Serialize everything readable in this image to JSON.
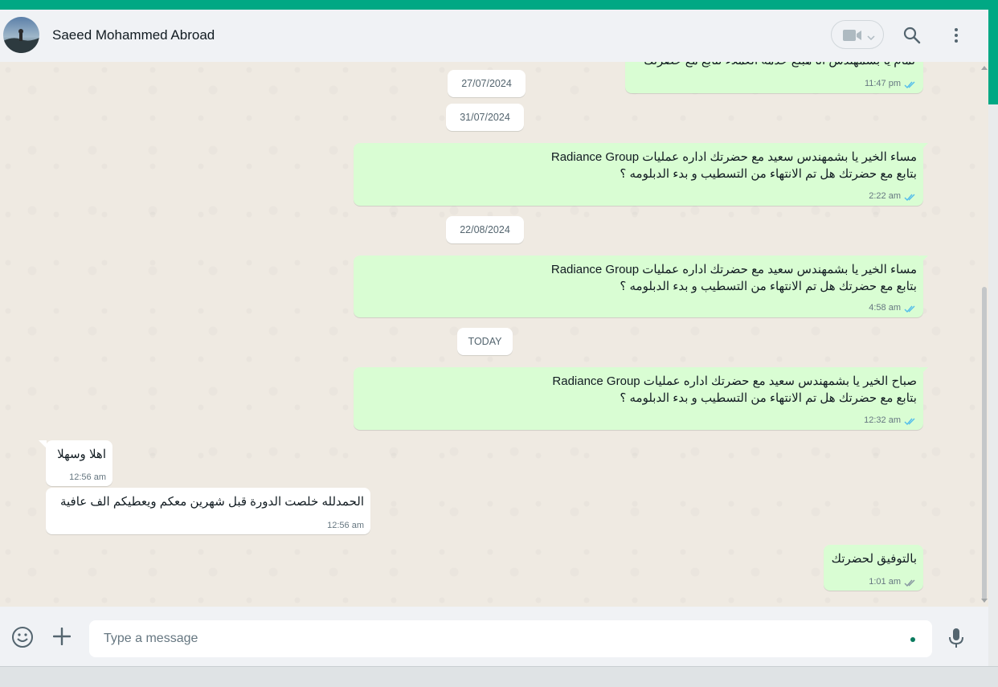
{
  "header": {
    "contact_name": "Saeed Mohammed Abroad"
  },
  "dates": {
    "d1": "27/07/2024",
    "d2": "31/07/2024",
    "d3": "22/08/2024",
    "d4": "TODAY"
  },
  "messages": [
    {
      "direction": "out",
      "text": "تمام يا بشمهندس انا هبلغ خدمه العملاء تتابع مع حضرتك",
      "time": "11:47 pm",
      "status": "read"
    },
    {
      "direction": "out",
      "line1": "مساء الخير يا بشمهندس سعيد مع  حضرتك اداره عمليات Radiance Group",
      "line2": "بتابع مع حضرتك هل تم الانتهاء من التسطيب و بدء الدبلومه ؟",
      "time": "2:22 am",
      "status": "read"
    },
    {
      "direction": "out",
      "line1": "مساء الخير يا بشمهندس سعيد مع  حضرتك اداره عمليات Radiance Group",
      "line2": "بتابع مع حضرتك هل تم الانتهاء من التسطيب و بدء الدبلومه ؟",
      "time": "4:58 am",
      "status": "read"
    },
    {
      "direction": "out",
      "line1": "صباح الخير يا بشمهندس سعيد مع  حضرتك اداره عمليات Radiance Group",
      "line2": "بتابع مع حضرتك هل تم الانتهاء من التسطيب و بدء الدبلومه ؟",
      "time": "12:32 am",
      "status": "read"
    },
    {
      "direction": "in",
      "text": "اهلا وسهلا",
      "time": "12:56 am"
    },
    {
      "direction": "in",
      "text": "الحمدلله خلصت الدورة قبل شهرين معكم ويعطيكم الف عافية",
      "time": "12:56 am"
    },
    {
      "direction": "out",
      "text": "بالتوفيق لحضرتك",
      "time": "1:01 am",
      "status": "delivered"
    }
  ],
  "composer": {
    "placeholder": "Type a message"
  },
  "colors": {
    "accent": "#00a884",
    "outgoing_bubble": "#d9fdd3",
    "incoming_bubble": "#ffffff",
    "read_tick": "#53bdeb",
    "delivered_tick": "#8696a0"
  },
  "icons": [
    "video-call-icon",
    "chevron-down-icon",
    "search-icon",
    "menu-icon",
    "emoji-icon",
    "plus-icon",
    "microphone-icon",
    "double-check-icon"
  ]
}
